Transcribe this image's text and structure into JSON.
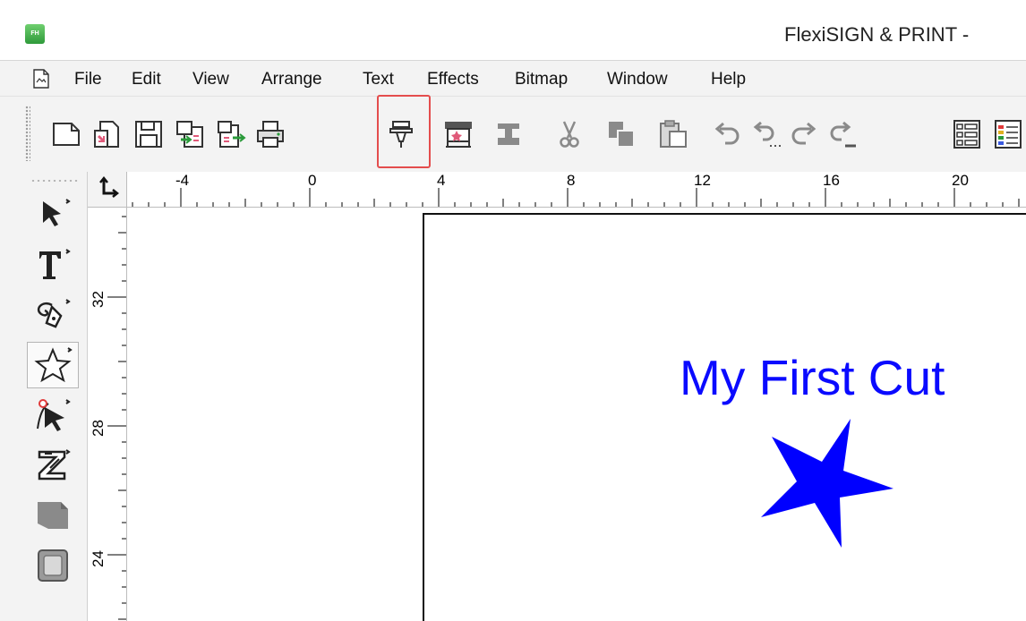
{
  "window": {
    "title": "FlexiSIGN & PRINT -",
    "logo_text": "FH"
  },
  "menu": {
    "items": [
      "File",
      "Edit",
      "View",
      "Arrange",
      "Text",
      "Effects",
      "Bitmap",
      "Window",
      "Help"
    ]
  },
  "toolbar": {
    "buttons": [
      "new-icon",
      "open-icon",
      "save-icon",
      "import-icon",
      "export-icon",
      "print-icon",
      "cut-contour-icon",
      "rip-and-print-icon",
      "weed-icon",
      "scissors-icon",
      "copy-icon",
      "paste-icon",
      "undo-icon",
      "undo-list-icon",
      "redo-icon",
      "redo-list-icon",
      "position-size-icon",
      "color-palette-icon"
    ],
    "highlighted": "cut-contour-icon",
    "highlight_color": "#e44d4d"
  },
  "toolbox": {
    "tools": [
      "select-tool-icon",
      "text-tool-icon",
      "pen-tool-icon",
      "shape-star-tool-icon",
      "node-edit-tool-icon",
      "zigzag-tool-icon",
      "fill-tool-icon",
      "frame-tool-icon"
    ],
    "active": "shape-star-tool-icon"
  },
  "rulers": {
    "horizontal_labels": [
      "-4",
      "0",
      "4",
      "8",
      "12",
      "16",
      "20"
    ],
    "vertical_labels": [
      "32",
      "28",
      "24"
    ]
  },
  "canvas": {
    "text": "My First Cut",
    "text_color": "#0a0aff",
    "shape": "star",
    "shape_color": "#0000ff"
  }
}
